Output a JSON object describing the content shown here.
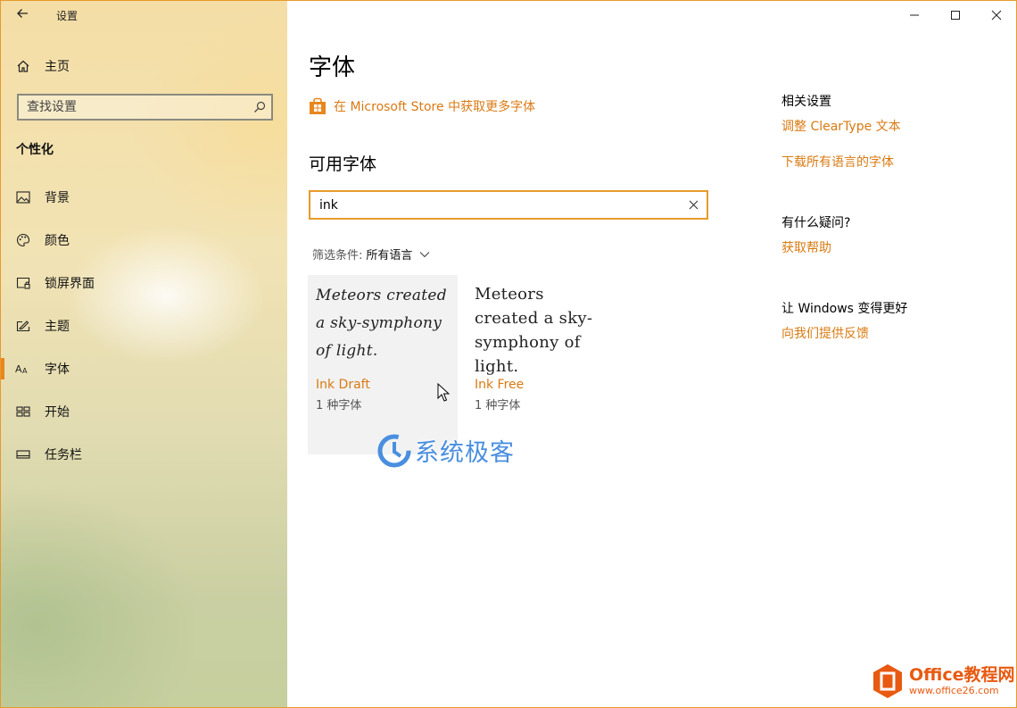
{
  "window": {
    "title": "设置",
    "back_icon": "arrow-left-icon",
    "buttons": [
      "minimize-icon",
      "maximize-icon",
      "close-icon"
    ]
  },
  "sidebar": {
    "home_label": "主页",
    "search_placeholder": "查找设置",
    "section_title": "个性化",
    "items": [
      {
        "label": "背景",
        "icon": "picture-icon",
        "selected": false
      },
      {
        "label": "颜色",
        "icon": "palette-icon",
        "selected": false
      },
      {
        "label": "锁屏界面",
        "icon": "lock-screen-icon",
        "selected": false
      },
      {
        "label": "主题",
        "icon": "theme-icon",
        "selected": false
      },
      {
        "label": "字体",
        "icon": "font-icon",
        "selected": true
      },
      {
        "label": "开始",
        "icon": "start-icon",
        "selected": false
      },
      {
        "label": "任务栏",
        "icon": "taskbar-icon",
        "selected": false
      }
    ]
  },
  "main": {
    "title": "字体",
    "store_link": "在 Microsoft Store 中获取更多字体",
    "available_title": "可用字体",
    "search_value": "ink",
    "filter_label": "筛选条件:",
    "filter_value": "所有语言",
    "fonts": [
      {
        "sample": "Meteors created a sky-symphony of light.",
        "name": "Ink Draft",
        "count": "1 种字体"
      },
      {
        "sample": "Meteors created a sky-symphony of light.",
        "name": "Ink Free",
        "count": "1 种字体"
      }
    ]
  },
  "related": {
    "title": "相关设置",
    "link1": "调整 ClearType 文本",
    "link2": "下载所有语言的字体",
    "question_title": "有什么疑问?",
    "help_link": "获取帮助",
    "improve_title": "让 Windows 变得更好",
    "feedback_link": "向我们提供反馈"
  },
  "watermarks": {
    "center_text": "系统极客",
    "corner_line1": "Office教程网",
    "corner_line2": "www.office26.com"
  },
  "colors": {
    "accent": "#e8871e",
    "link": "#d97a12"
  }
}
